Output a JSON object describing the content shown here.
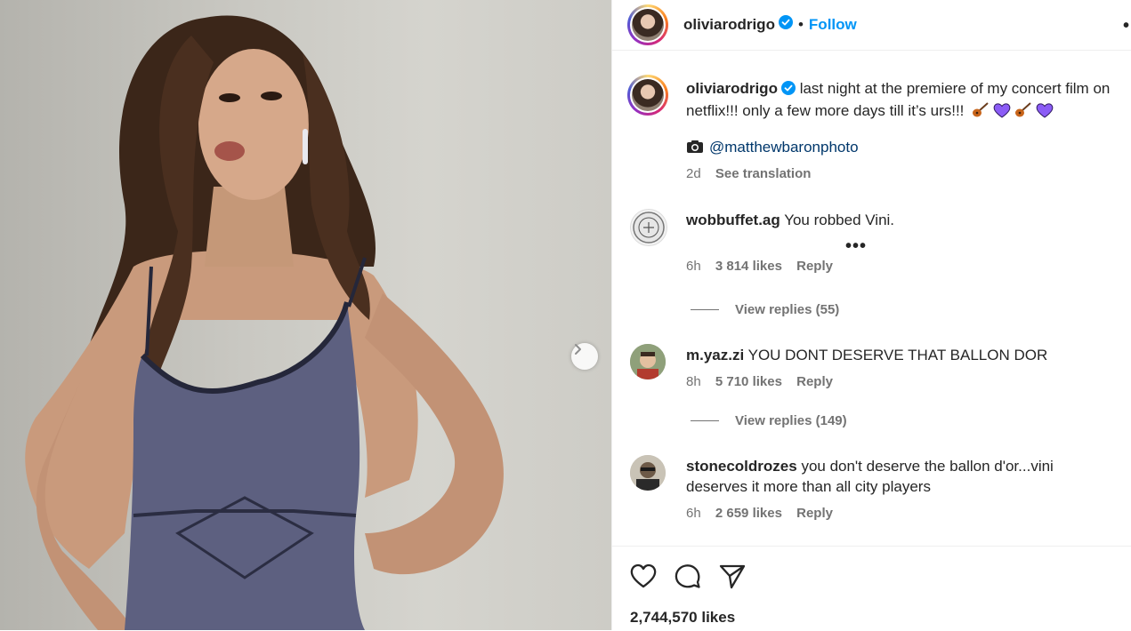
{
  "post": {
    "username": "oliviarodrigo",
    "follow_label": "Follow",
    "more_label": "•••",
    "caption_text": "last night at the premiere of my concert film on netflix!!! only a few more days till it’s urs!!!",
    "credit_handle": "@matthewbaronphoto",
    "caption_time": "2d",
    "see_translation": "See translation",
    "likes": "2,744,570 likes"
  },
  "comments": [
    {
      "username": "wobbuffet.ag",
      "text": "You robbed Vini.",
      "time": "6h",
      "likes": "3 814 likes",
      "reply": "Reply",
      "view_replies": "View replies (55)"
    },
    {
      "username": "m.yaz.zi",
      "text": "YOU DONT DESERVE THAT BALLON DOR",
      "time": "8h",
      "likes": "5 710 likes",
      "reply": "Reply",
      "view_replies": "View replies (149)"
    },
    {
      "username": "stonecoldrozes",
      "text": "you don't deserve the ballon d'or...vini deserves it more than all city players",
      "time": "6h",
      "likes": "2 659 likes",
      "reply": "Reply"
    }
  ],
  "icons": {
    "verified": "verified-badge-icon",
    "camera": "camera-icon",
    "like": "heart-icon",
    "comment": "comment-icon",
    "share": "send-icon",
    "next": "chevron-right-icon",
    "emoji": [
      "guitar-icon",
      "purple-heart-icon",
      "guitar-icon",
      "purple-heart-icon"
    ]
  },
  "colors": {
    "follow_blue": "#0095f6",
    "link_blue": "#00376b",
    "verified_blue": "#0095f6",
    "heart_purple": "#8b5cf6",
    "muted": "#737373"
  }
}
